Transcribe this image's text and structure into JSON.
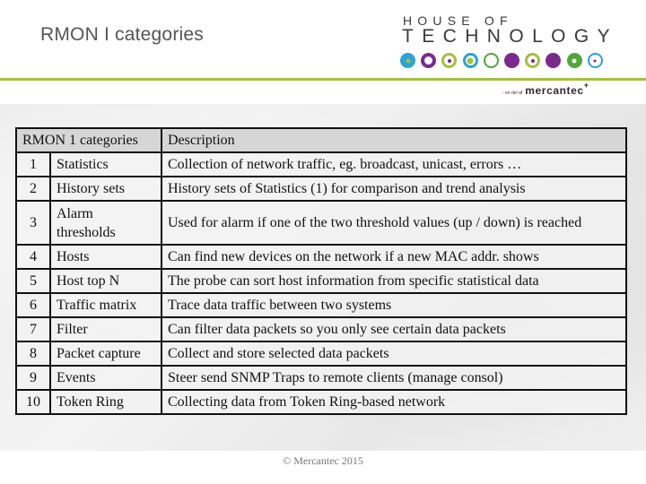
{
  "slide": {
    "title": "RMON I categories",
    "footer": "© Mercantec 2015"
  },
  "logo": {
    "line1": "HOUSE OF",
    "line2": "TECHNOLOGY",
    "tagline_small": "- en del af",
    "tagline_brand": "mercantec",
    "tagline_plus": "+",
    "colors": {
      "rule": "#a3c13a",
      "blue": "#2aa3d8",
      "purple": "#7b2a8c",
      "lime": "#a3c13a",
      "green": "#4fa838"
    },
    "dots": [
      {
        "ring": "#2aa3d8",
        "fill": "#2aa3d8",
        "inner": "#a3c13a",
        "style": "filled-center"
      },
      {
        "ring": "#7b2a8c",
        "fill": "#ffffff",
        "inner": "",
        "style": "ring"
      },
      {
        "ring": "#a3c13a",
        "fill": "#ffffff",
        "inner": "#7b2a8c",
        "style": "ring-dot"
      },
      {
        "ring": "#2aa3d8",
        "fill": "#ffffff",
        "inner": "#a3c13a",
        "style": "ring-bigdot"
      },
      {
        "ring": "#4fa838",
        "fill": "#ffffff",
        "inner": "",
        "style": "thin-ring"
      },
      {
        "ring": "#7b2a8c",
        "fill": "#7b2a8c",
        "inner": "",
        "style": "solid"
      },
      {
        "ring": "#a3c13a",
        "fill": "#ffffff",
        "inner": "#7b2a8c",
        "style": "ring-dot"
      },
      {
        "ring": "#7b2a8c",
        "fill": "#7b2a8c",
        "inner": "",
        "style": "solid"
      },
      {
        "ring": "#4fa838",
        "fill": "#4fa838",
        "inner": "#ffffff",
        "style": "filled-center"
      },
      {
        "ring": "#2aa3d8",
        "fill": "#ffffff",
        "inner": "#7b2a8c",
        "style": "thin-ring-dot"
      }
    ]
  },
  "table": {
    "headers": [
      "RMON 1 categories",
      "Description"
    ],
    "rows": [
      {
        "num": "1",
        "name": "Statistics",
        "desc": "Collection of network traffic, eg. broadcast, unicast,  errors …"
      },
      {
        "num": "2",
        "name": "History sets",
        "desc": "History sets of Statistics (1) for comparison and trend analysis"
      },
      {
        "num": "3",
        "name": "Alarm thresholds",
        "desc": "Used for alarm if one of the two threshold values (up / down) is reached"
      },
      {
        "num": "4",
        "name": "Hosts",
        "desc": "Can find new devices on the network if a new MAC addr. shows"
      },
      {
        "num": "5",
        "name": "Host top N",
        "desc": "The probe can sort host information from specific statistical data"
      },
      {
        "num": "6",
        "name": "Traffic matrix",
        "desc": "Trace data traffic between two systems"
      },
      {
        "num": "7",
        "name": "Filter",
        "desc": "Can filter data packets so you only see certain data packets"
      },
      {
        "num": "8",
        "name": "Packet capture",
        "desc": "Collect and store selected data packets"
      },
      {
        "num": "9",
        "name": "Events",
        "desc": "Steer send SNMP Traps to remote clients (manage consol)"
      },
      {
        "num": "10",
        "name": "Token Ring",
        "desc": "Collecting data from Token Ring-based network"
      }
    ]
  }
}
